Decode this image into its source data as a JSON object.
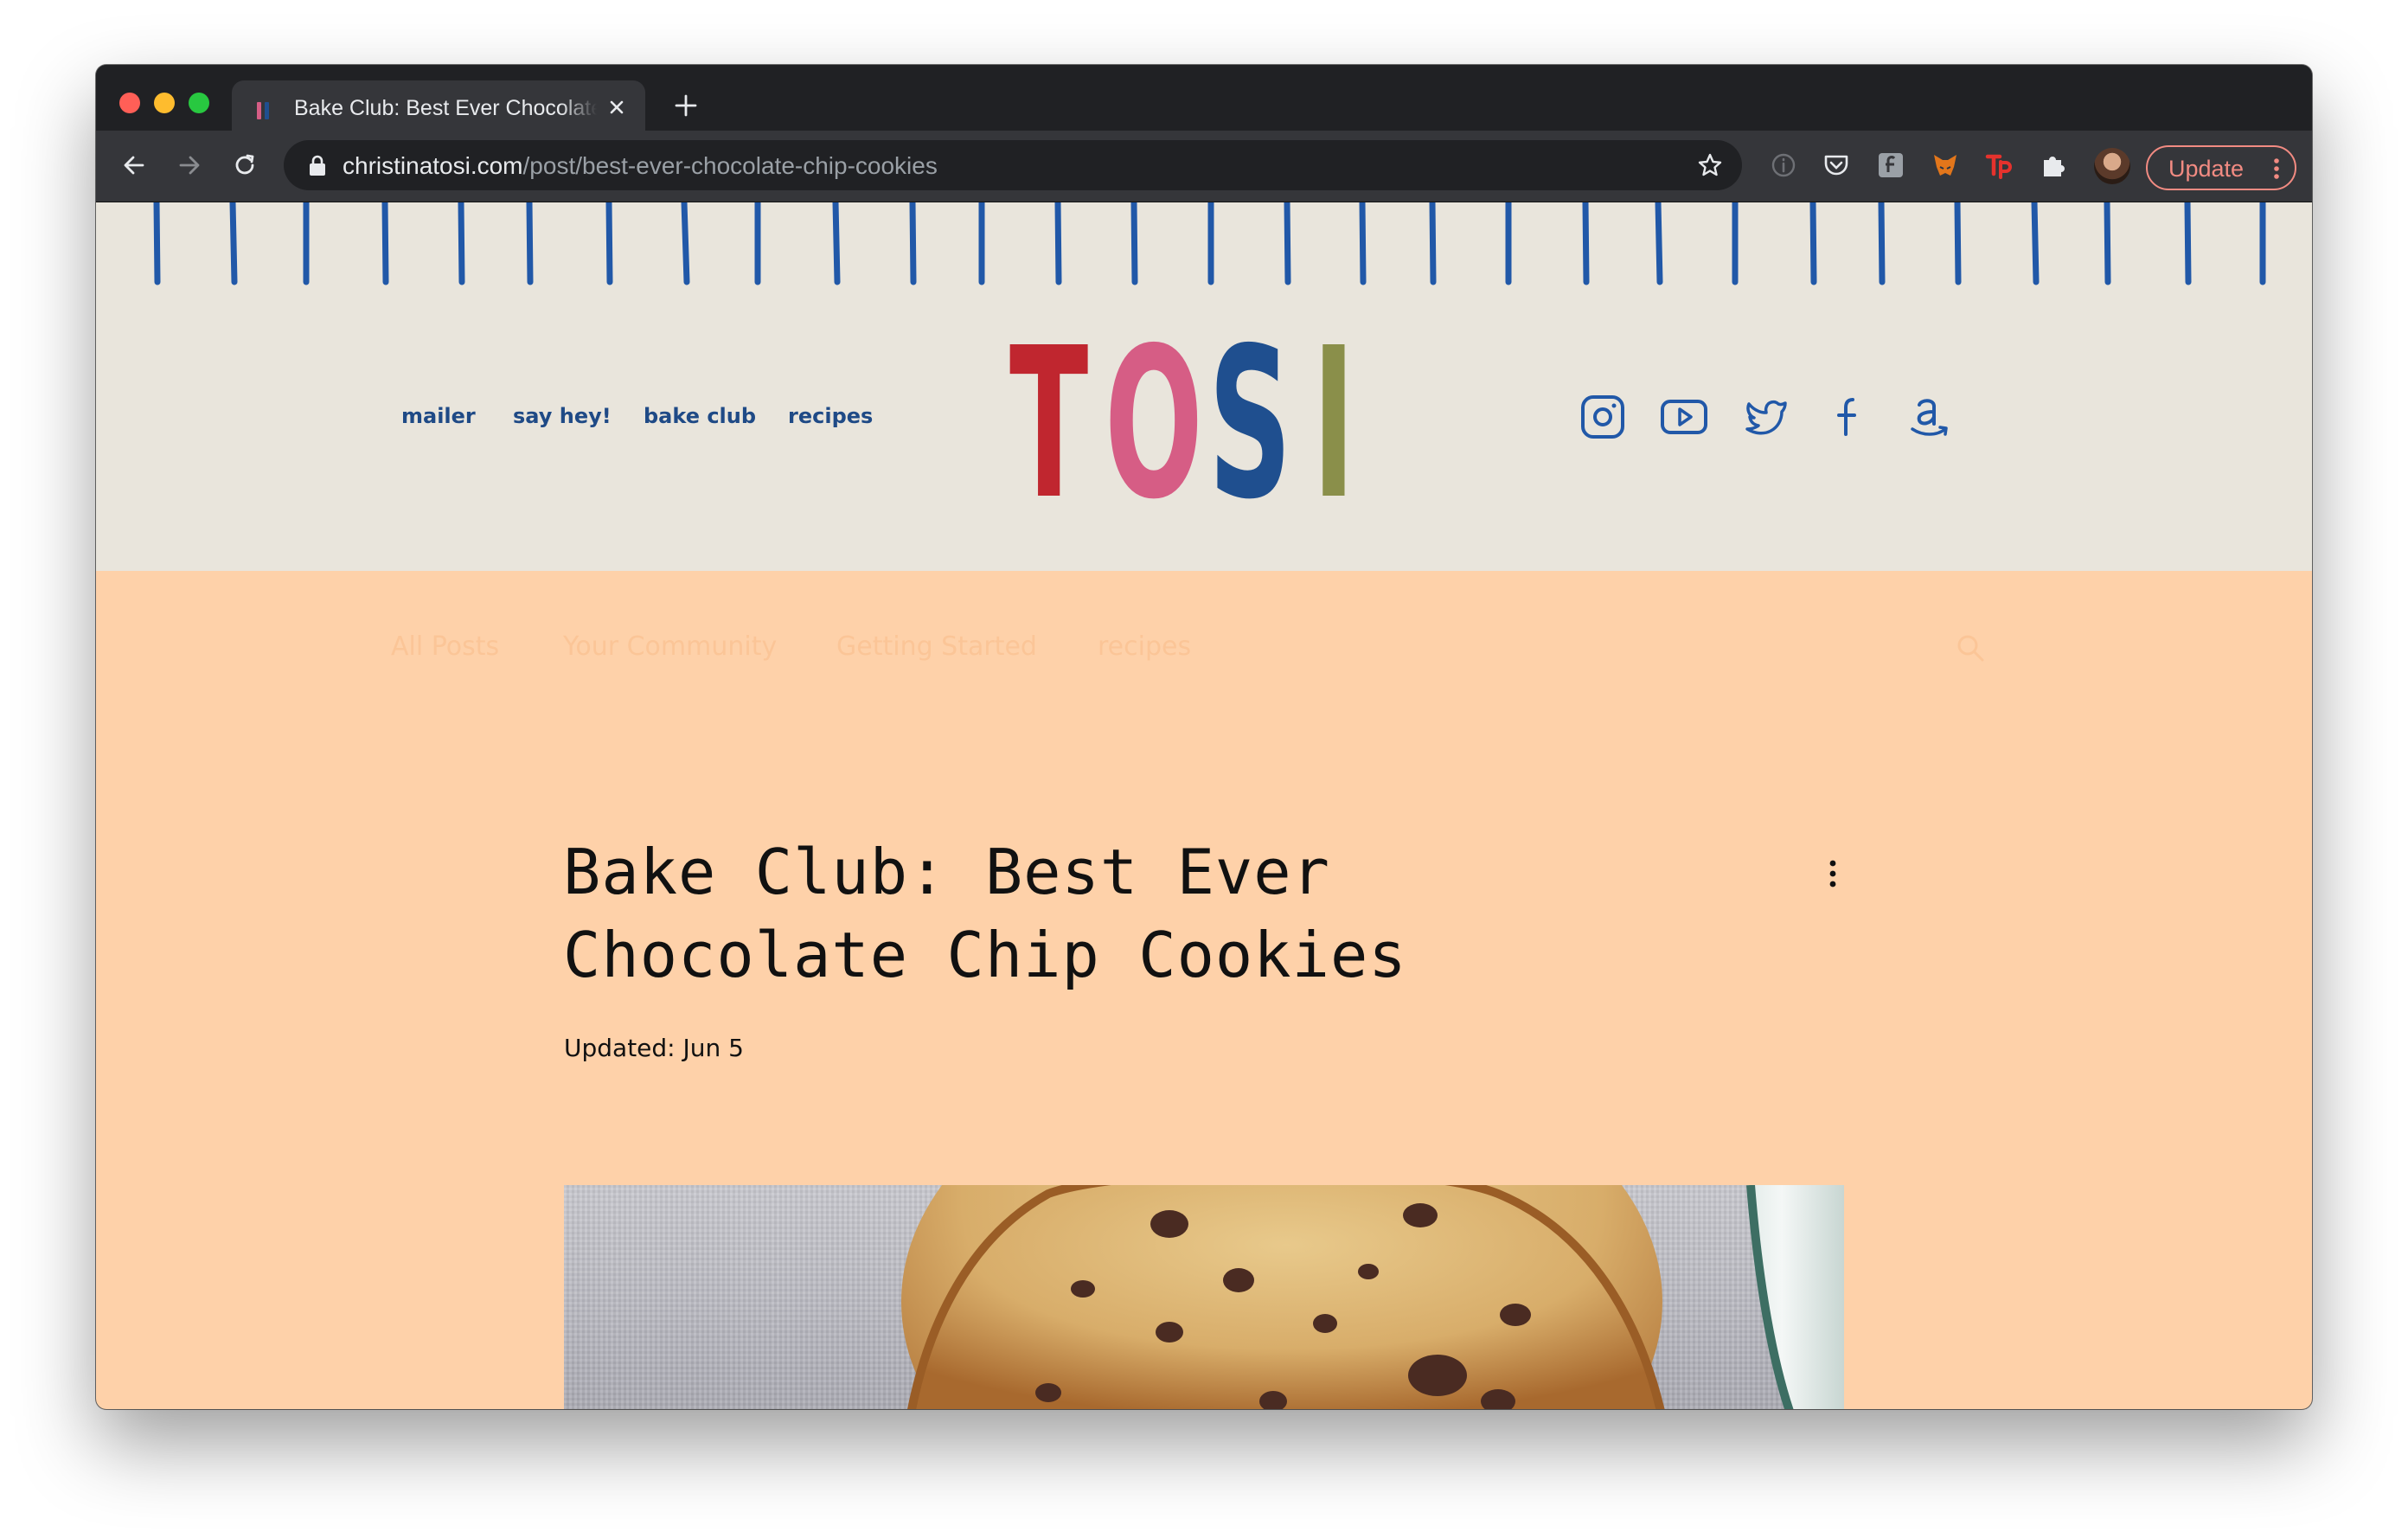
{
  "browser": {
    "tab_title": "Bake Club: Best Ever Chocolate Chip Cookies",
    "url_host": "christinatosi.com",
    "url_path": "/post/best-ever-chocolate-chip-cookies",
    "update_label": "Update"
  },
  "site": {
    "nav": [
      "mailer",
      "say hey!",
      "bake club",
      "recipes"
    ],
    "logo": {
      "letters": [
        "T",
        "O",
        "S",
        "I"
      ],
      "colors": [
        "#c0262f",
        "#d65d85",
        "#1f4f8f",
        "#8a8f4a"
      ]
    },
    "social_icons": [
      "instagram-icon",
      "youtube-icon",
      "twitter-icon",
      "facebook-icon",
      "amazon-icon"
    ]
  },
  "blog": {
    "categories": [
      "All Posts",
      "Your Community",
      "Getting Started",
      "recipes"
    ],
    "post": {
      "title_line1": "Bake Club: Best Ever",
      "title_line2": "Chocolate Chip Cookies",
      "updated": "Updated: Jun 5"
    }
  },
  "colors": {
    "header_bg": "#e9e5dc",
    "content_bg": "#fed1a9",
    "accent_blue": "#1f4a86"
  }
}
